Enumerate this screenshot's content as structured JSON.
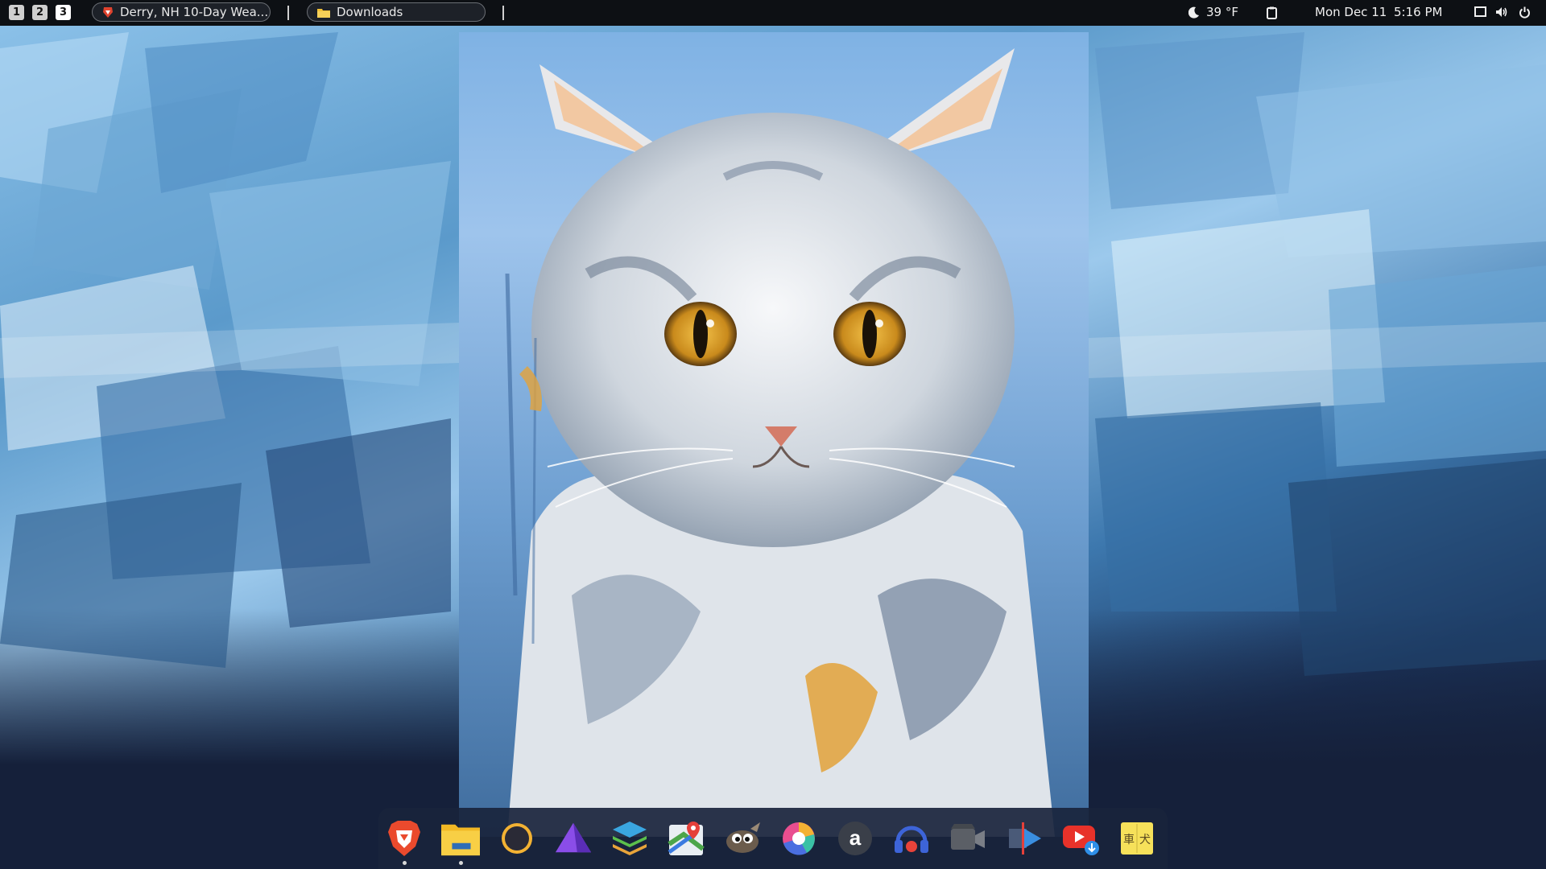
{
  "topbar": {
    "workspaces": [
      {
        "label": "1",
        "active": false
      },
      {
        "label": "2",
        "active": false
      },
      {
        "label": "3",
        "active": true
      }
    ],
    "tasks": [
      {
        "label": "Derry, NH 10-Day Wea...",
        "icon": "brave-lion-icon"
      },
      {
        "label": "Downloads",
        "icon": "folder-icon"
      }
    ],
    "weather": {
      "icon": "moon-icon",
      "temp": "39 °F"
    },
    "clipboard_icon": "clipboard-icon",
    "date": "Mon Dec 11",
    "time": "5:16 PM",
    "tray_icons": [
      "screen-icon",
      "volume-icon",
      "power-icon"
    ]
  },
  "dock": {
    "items": [
      {
        "name": "brave-browser-icon",
        "running": true
      },
      {
        "name": "file-manager-icon",
        "running": true
      },
      {
        "name": "eclipse-icon",
        "running": false
      },
      {
        "name": "purple-triangle-app-icon",
        "running": false
      },
      {
        "name": "layers-app-icon",
        "running": false
      },
      {
        "name": "maps-icon",
        "running": false
      },
      {
        "name": "gimp-icon",
        "running": false
      },
      {
        "name": "color-picker-icon",
        "running": false
      },
      {
        "name": "amazon-icon",
        "running": false
      },
      {
        "name": "music-headphones-icon",
        "running": false
      },
      {
        "name": "video-camera-icon",
        "running": false
      },
      {
        "name": "video-editor-icon",
        "running": false
      },
      {
        "name": "youtube-downloader-icon",
        "running": false
      },
      {
        "name": "japanese-dictionary-icon",
        "running": false
      }
    ]
  },
  "colors": {
    "panel": "#0d1014",
    "dock": "#19243c",
    "wallpaper_light": "#9cc9ec",
    "wallpaper_dark": "#15203a"
  }
}
